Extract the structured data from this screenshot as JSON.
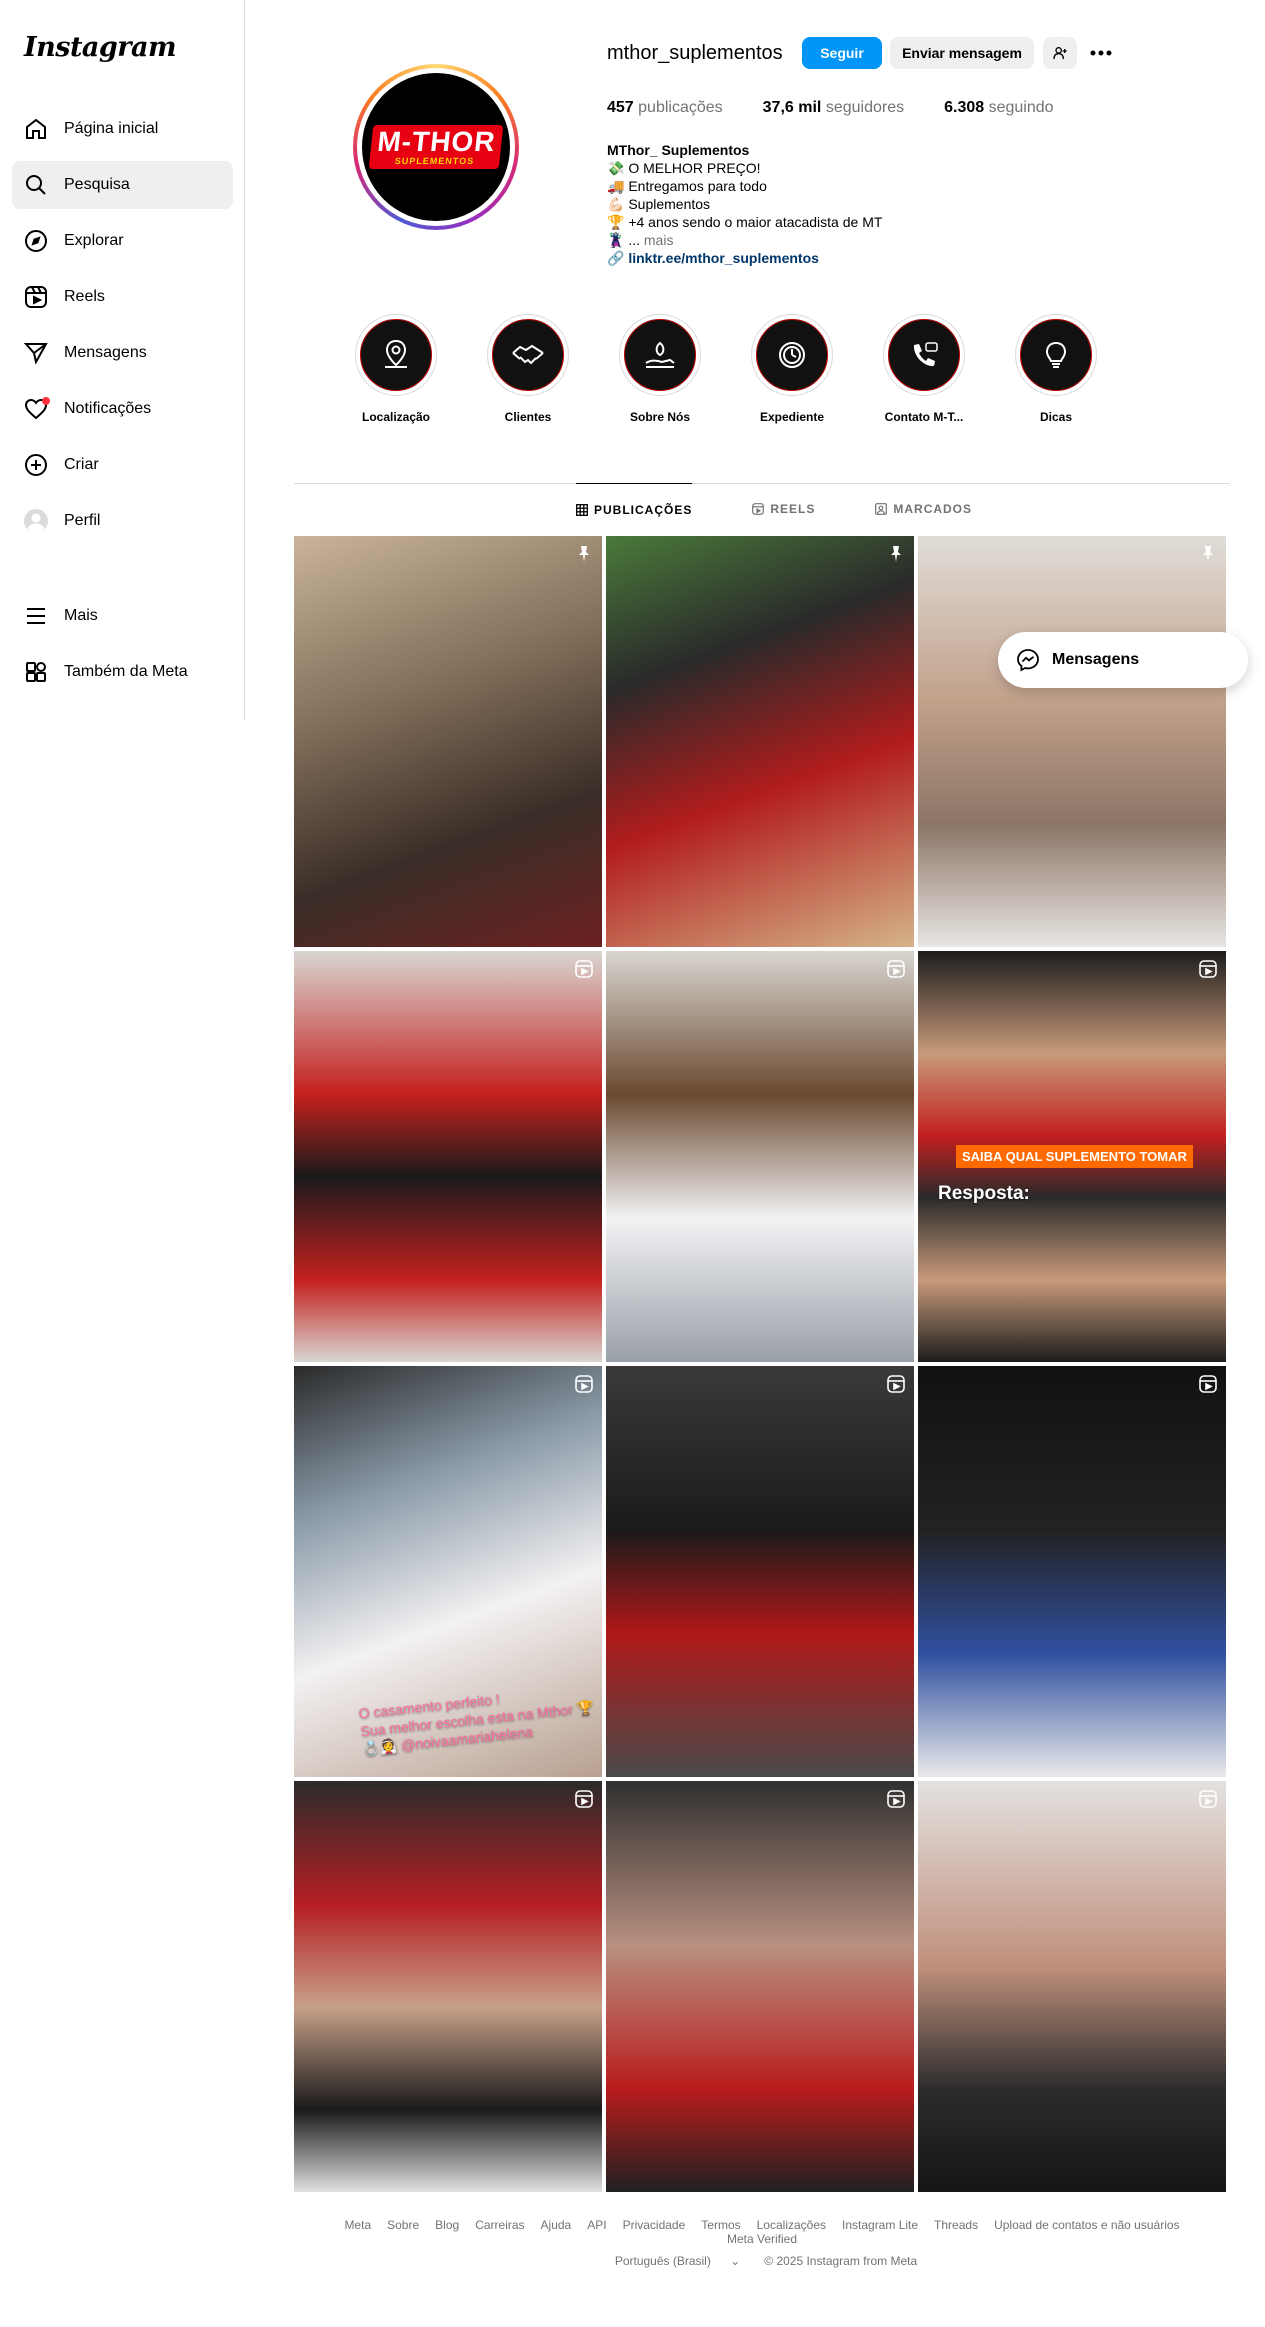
{
  "brand": {
    "logo_text": "Instagram"
  },
  "sidebar": {
    "items": [
      {
        "label": "Página inicial",
        "icon": "home-icon"
      },
      {
        "label": "Pesquisa",
        "icon": "search-icon"
      },
      {
        "label": "Explorar",
        "icon": "compass-icon"
      },
      {
        "label": "Reels",
        "icon": "reels-icon"
      },
      {
        "label": "Mensagens",
        "icon": "send-icon"
      },
      {
        "label": "Notificações",
        "icon": "heart-icon"
      },
      {
        "label": "Criar",
        "icon": "plus-square-icon"
      },
      {
        "label": "Perfil",
        "icon": "avatar-icon"
      }
    ],
    "bottom_items": [
      {
        "label": "Mais",
        "icon": "menu-icon"
      },
      {
        "label": "Também da Meta",
        "icon": "meta-apps-icon"
      }
    ]
  },
  "profile": {
    "username": "mthor_suplementos",
    "follow_label": "Seguir",
    "message_label": "Enviar mensagem",
    "logo_text": "M-THOR",
    "logo_sub": "SUPLEMENTOS",
    "stats": [
      {
        "value": "457",
        "label": "publicações"
      },
      {
        "value": "37,6 mil",
        "label": "seguidores"
      },
      {
        "value": "6.308",
        "label": "seguindo"
      }
    ],
    "bio": {
      "name": "MThor_ Suplementos",
      "lines": [
        "💸 O MELHOR PREÇO!",
        "🚚  Entregamos para todo",
        "💪🏻 Suplementos",
        "🏆  +4 anos sendo o maior atacadista de MT",
        "🦹‍♂️ ..."
      ],
      "more": "mais",
      "link": "linktr.ee/mthor_suplementos"
    }
  },
  "highlights": [
    {
      "label": "Localização",
      "icon": "location-pin-icon"
    },
    {
      "label": "Clientes",
      "icon": "handshake-icon"
    },
    {
      "label": "Sobre Nós",
      "icon": "hand-leaf-icon"
    },
    {
      "label": "Expediente",
      "icon": "clock-icon"
    },
    {
      "label": "Contato M-T...",
      "icon": "phone-chat-icon"
    },
    {
      "label": "Dicas",
      "icon": "lightbulb-icon"
    }
  ],
  "tabs": [
    {
      "label": "PUBLICAÇÕES",
      "icon": "grid-icon"
    },
    {
      "label": "REELS",
      "icon": "reels-icon"
    },
    {
      "label": "MARCADOS",
      "icon": "tag-icon"
    }
  ],
  "posts": [
    {
      "badge": "pin-icon"
    },
    {
      "badge": "pin-icon"
    },
    {
      "badge": "pin-icon"
    },
    {
      "badge": "reel-icon"
    },
    {
      "badge": "reel-icon"
    },
    {
      "badge": "reel-icon",
      "caption_orange": "SAIBA QUAL SUPLEMENTO TOMAR",
      "caption_white": "Resposta:"
    },
    {
      "badge": "reel-icon",
      "caption_pink": "O casamento perfeito !\nSua melhor escolha esta na Mthor 🏆\n💍👰 @noivaamariahelena"
    },
    {
      "badge": "reel-icon"
    },
    {
      "badge": "reel-icon"
    },
    {
      "badge": "reel-icon"
    },
    {
      "badge": "reel-icon"
    },
    {
      "badge": "reel-icon"
    }
  ],
  "floating_messages": {
    "label": "Mensagens"
  },
  "footer": {
    "links": [
      "Meta",
      "Sobre",
      "Blog",
      "Carreiras",
      "Ajuda",
      "API",
      "Privacidade",
      "Termos",
      "Localizações",
      "Instagram Lite",
      "Threads",
      "Upload de contatos e não usuários",
      "Meta Verified"
    ],
    "language": "Português (Brasil)",
    "copyright": "© 2025 Instagram from Meta"
  },
  "colors": {
    "accent": "#0095f6",
    "brand_red": "#e60012",
    "notification": "#ff3040"
  }
}
